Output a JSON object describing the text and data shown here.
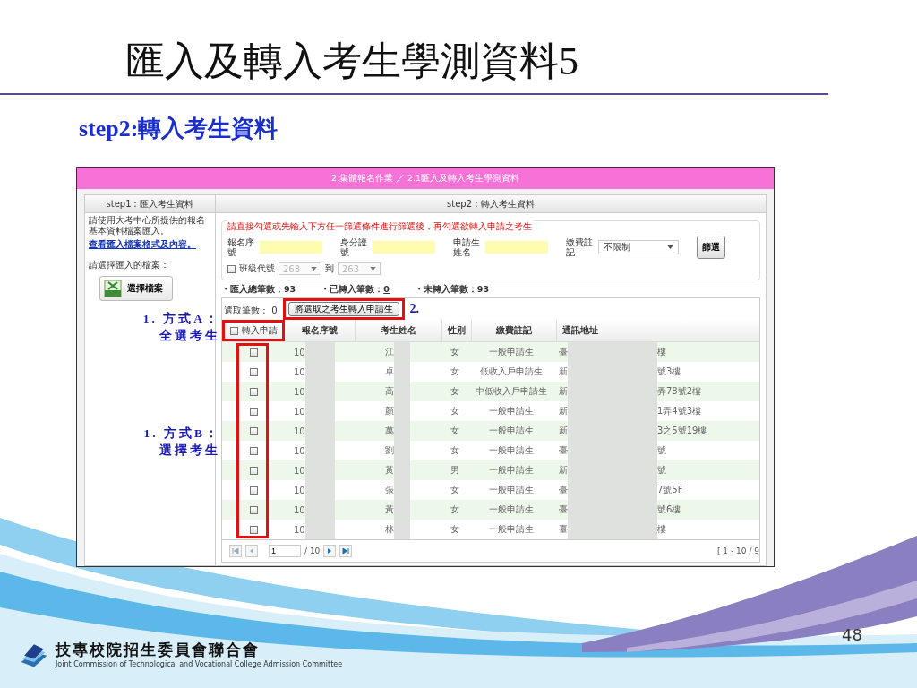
{
  "slide": {
    "title": "匯入及轉入考生學測資料5",
    "subtitle": "step2:轉入考生資料",
    "page_number": "48",
    "org_name": "技專校院招生委員會聯合會",
    "org_name_en": "Joint Commission of Technological and Vocational College Admission Committee"
  },
  "app": {
    "breadcrumb": "2.集體報名作業 ／ 2.1匯入及轉入考生學測資料",
    "step1": {
      "header": "step1：匯入考生資料",
      "instructions": "請使用大考中心所提供的報名基本資料檔案匯入。",
      "link": "查看匯入檔案格式及內容。",
      "file_label": "請選擇匯入的檔案：",
      "file_button": "選擇檔案"
    },
    "annotations": [
      {
        "lines": [
          "1. 方式A：",
          "全選考生"
        ]
      },
      {
        "lines": [
          "1. 方式B：",
          "選擇考生"
        ]
      }
    ],
    "step2": {
      "header": "step2：轉入考生資料",
      "notice": "請直接勾選或先輸入下方任一篩選條件進行篩選後，再勾選欲轉入申請之考生",
      "fields": [
        {
          "label": "報名序號"
        },
        {
          "label": "身分證號"
        },
        {
          "label": "申請生姓名"
        }
      ],
      "payment": {
        "label": "繳費註記",
        "value": "不限制"
      },
      "filter_button": "篩選",
      "class_filter": {
        "checked": false,
        "label": "班級代號",
        "from": "263",
        "to_label": "到",
        "to": "263",
        "disabled": true
      },
      "stats": [
        {
          "label": "・匯入總筆數：",
          "value": "93",
          "underline": false
        },
        {
          "label": "・已轉入筆數：",
          "value": "0",
          "underline": true
        },
        {
          "label": "・未轉入筆數：",
          "value": "93",
          "underline": false
        }
      ],
      "selected_label": "選取筆數：",
      "selected_count": "0",
      "transfer_button": "將選取之考生轉入申請生",
      "step_mark": "2.",
      "header_checkbox": {
        "checked": false,
        "label": "轉入申請"
      },
      "columns": [
        "報名序號",
        "考生姓名",
        "性別",
        "繳費註記",
        "通訊地址"
      ],
      "rows": [
        {
          "checked": false,
          "seq": "10",
          "name": "江",
          "gender": "女",
          "payment": "一般申請生",
          "addr_start": "臺",
          "addr_end": "樓"
        },
        {
          "checked": false,
          "seq": "10",
          "name": "卓",
          "gender": "女",
          "payment": "低收入戶申請生",
          "addr_start": "新",
          "addr_end": "號3樓"
        },
        {
          "checked": false,
          "seq": "10",
          "name": "高",
          "gender": "女",
          "payment": "中低收入戶申請生",
          "addr_start": "新",
          "addr_end": "弄78號2樓"
        },
        {
          "checked": false,
          "seq": "10",
          "name": "顏",
          "gender": "女",
          "payment": "一般申請生",
          "addr_start": "新",
          "addr_end": "1弄4號3樓"
        },
        {
          "checked": false,
          "seq": "10",
          "name": "萬",
          "gender": "女",
          "payment": "一般申請生",
          "addr_start": "新",
          "addr_end": "3之5號19樓"
        },
        {
          "checked": false,
          "seq": "10",
          "name": "劉",
          "gender": "女",
          "payment": "一般申請生",
          "addr_start": "臺",
          "addr_end": "號"
        },
        {
          "checked": false,
          "seq": "10",
          "name": "黃",
          "gender": "男",
          "payment": "一般申請生",
          "addr_start": "新",
          "addr_end": "號"
        },
        {
          "checked": false,
          "seq": "10",
          "name": "張",
          "gender": "女",
          "payment": "一般申請生",
          "addr_start": "臺",
          "addr_end": "7號5F"
        },
        {
          "checked": false,
          "seq": "10",
          "name": "黃",
          "gender": "女",
          "payment": "一般申請生",
          "addr_start": "臺",
          "addr_end": "號6樓"
        },
        {
          "checked": false,
          "seq": "10",
          "name": "林",
          "gender": "女",
          "payment": "一般申請生",
          "addr_start": "臺",
          "addr_end": "樓"
        }
      ],
      "pager": {
        "page": "1",
        "total": "/ 10",
        "range": "[ 1 - 10 / 9"
      }
    }
  }
}
